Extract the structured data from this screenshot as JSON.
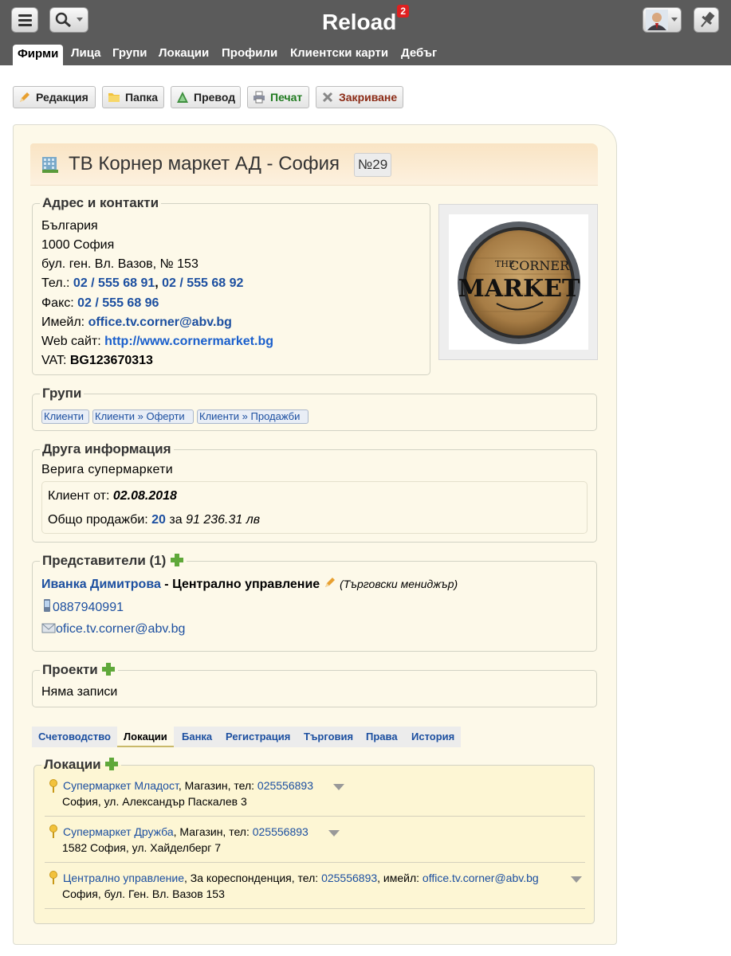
{
  "app": {
    "title": "Reload",
    "badge": "2"
  },
  "nav": [
    "Фирми",
    "Лица",
    "Групи",
    "Локации",
    "Профили",
    "Клиентски карти",
    "Дебъг"
  ],
  "toolbar": {
    "edit": "Редакция",
    "folder": "Папка",
    "transfer": "Превод",
    "print": "Печат",
    "close": "Закриване"
  },
  "company": {
    "name": "ТВ Корнер маркет АД - София",
    "number": "№29"
  },
  "address": {
    "legend": "Адрес и контакти",
    "country": "България",
    "city": "1000 София",
    "street": "бул. ген. Вл. Вазов, № 153",
    "phone_label": "Тел.: ",
    "phone1": "02 / 555 68 91",
    "phone_sep": ", ",
    "phone2": "02 / 555 68 92",
    "fax_label": "Факс: ",
    "fax": "02 / 555 68 96",
    "email_label": "Имейл: ",
    "email": "office.tv.corner@abv.bg",
    "web_label": "Web сайт: ",
    "web": "http://www.cornermarket.bg",
    "vat_label": "VAT: ",
    "vat": "BG123670313"
  },
  "logo": {
    "line1": "THE",
    "line2": "CORNER",
    "line3": "MARKET"
  },
  "groups": {
    "legend": "Групи",
    "items": [
      "Клиенти",
      "Клиенти » Оферти",
      "Клиенти » Продажби"
    ]
  },
  "other": {
    "legend": "Друга информация",
    "description": "Верига супермаркети",
    "client_since_label": "Клиент от: ",
    "client_since": "02.08.2018",
    "sales_label": "Общо продажби: ",
    "sales_count": "20",
    "sales_for": " за ",
    "sales_amount": "91 236.31 лв"
  },
  "reps": {
    "legend": "Представители (1)",
    "name": "Иванка Димитрова",
    "dept": " - Централно управление",
    "role": "(Търговски мениджър)",
    "phone": "0887940991",
    "email": "ofice.tv.corner@abv.bg"
  },
  "projects": {
    "legend": "Проекти",
    "empty": "Няма записи"
  },
  "tabs": [
    "Счетоводство",
    "Локации",
    "Банка",
    "Регистрация",
    "Търговия",
    "Права",
    "История"
  ],
  "locations": {
    "legend": "Локации",
    "items": [
      {
        "name": "Супермаркет Младост",
        "type": ", Магазин, тел: ",
        "phone": "025556893",
        "extra_label": "",
        "extra": "",
        "address": "София, ул. Александър Паскалев 3"
      },
      {
        "name": "Супермаркет Дружба",
        "type": ", Магазин, тел: ",
        "phone": "025556893",
        "extra_label": "",
        "extra": "",
        "address": "1582 София, ул. Хайделберг 7"
      },
      {
        "name": "Централно управление",
        "type": ", За кореспонденция, тел: ",
        "phone": "025556893",
        "extra_label": ", имейл: ",
        "extra": "office.tv.corner@abv.bg",
        "address": "София, бул. Ген. Вл. Вазов 153"
      }
    ]
  },
  "colors": {
    "topbar": "#5b5b5b",
    "link": "#1c4fa0",
    "card_bg": "#fdf9e9",
    "badge": "#e02020",
    "print_label": "#1f7a1f",
    "close_label": "#8b2a15"
  }
}
